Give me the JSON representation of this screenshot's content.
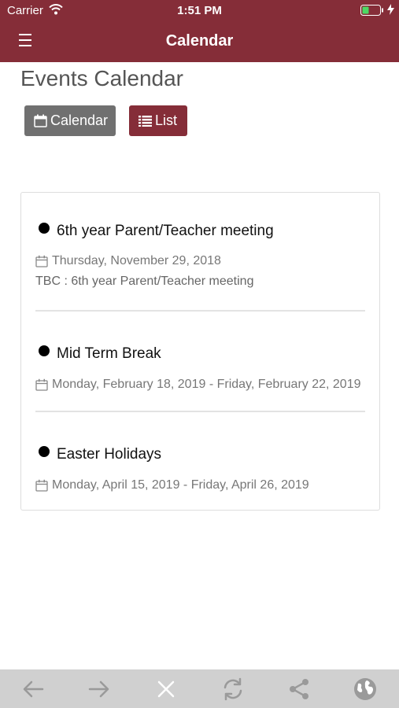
{
  "status_bar": {
    "carrier": "Carrier",
    "time": "1:51 PM"
  },
  "nav": {
    "title": "Calendar"
  },
  "page": {
    "heading": "Events Calendar"
  },
  "view_toggle": {
    "calendar_label": "Calendar",
    "list_label": "List"
  },
  "events": [
    {
      "title": "6th year Parent/Teacher meeting",
      "date": "Thursday, November 29, 2018",
      "description": "TBC : 6th year Parent/Teacher meeting"
    },
    {
      "title": "Mid Term Break",
      "date": "Monday, February 18, 2019 - Friday, February 22, 2019"
    },
    {
      "title": "Easter Holidays",
      "date": "Monday, April 15, 2019 - Friday, April 26, 2019"
    }
  ],
  "toolbar": {
    "icons": [
      "back-arrow-icon",
      "forward-arrow-icon",
      "close-icon",
      "refresh-icon",
      "share-icon",
      "globe-icon"
    ]
  },
  "colors": {
    "brand": "#852d38",
    "secondary_button": "#707070",
    "toolbar": "#d0d0d0"
  }
}
